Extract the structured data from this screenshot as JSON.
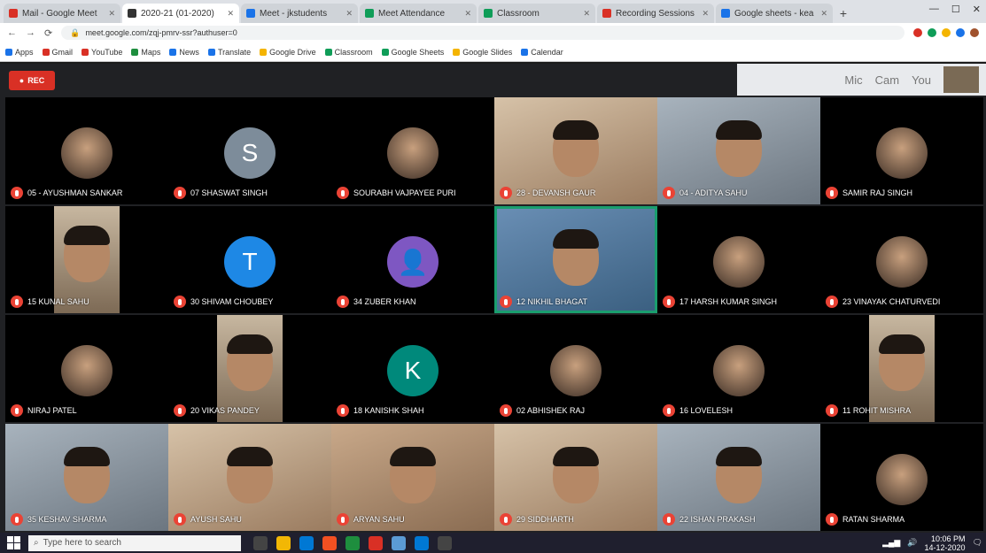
{
  "browser": {
    "tabs": [
      {
        "label": "Mail - Google Meet",
        "color": "#d93025",
        "active": false
      },
      {
        "label": "2020-21 (01-2020)",
        "color": "#333333",
        "active": true
      },
      {
        "label": "Meet - jkstudents",
        "color": "#1a73e8",
        "active": false
      },
      {
        "label": "Meet Attendance",
        "color": "#0f9d58",
        "active": false
      },
      {
        "label": "Classroom",
        "color": "#0f9d58",
        "active": false
      },
      {
        "label": "Recording Sessions",
        "color": "#d93025",
        "active": false
      },
      {
        "label": "Google sheets - kea",
        "color": "#1a73e8",
        "active": false
      }
    ],
    "url": "meet.google.com/zqj-pmrv-ssr?authuser=0",
    "bookmarks": [
      "Apps",
      "Gmail",
      "YouTube",
      "Maps",
      "News",
      "Translate",
      "Google Drive",
      "Classroom",
      "Google Sheets",
      "Google Slides",
      "Calendar"
    ]
  },
  "meet": {
    "presenting_label": "REC",
    "self_view_labels": [
      "Mic",
      "Cam",
      "You"
    ],
    "participants": [
      {
        "name": "05 - AYUSHMAN SANKAR",
        "kind": "photo",
        "speaking": false
      },
      {
        "name": "07 SHASWAT SINGH",
        "kind": "letter",
        "letter": "S",
        "bg": "#7d8c9a",
        "speaking": false
      },
      {
        "name": "SOURABH VAJPAYEE PURI",
        "kind": "photo",
        "speaking": false
      },
      {
        "name": "28 - DEVANSH GAUR",
        "kind": "video",
        "variant": "v3",
        "speaking": false
      },
      {
        "name": "04 - ADITYA SAHU",
        "kind": "video",
        "variant": "v2",
        "speaking": false
      },
      {
        "name": "SAMIR RAJ SINGH",
        "kind": "photo",
        "speaking": false
      },
      {
        "name": "15 KUNAL SAHU",
        "kind": "video-portrait",
        "speaking": false
      },
      {
        "name": "30 SHIVAM CHOUBEY",
        "kind": "letter",
        "letter": "T",
        "bg": "#1e88e5",
        "speaking": false
      },
      {
        "name": "34 ZUBER KHAN",
        "kind": "generic",
        "bg": "#7e57c2",
        "speaking": false
      },
      {
        "name": "12 NIKHIL BHAGAT",
        "kind": "video",
        "variant": "v4",
        "speaking": true
      },
      {
        "name": "17 HARSH KUMAR SINGH",
        "kind": "photo",
        "speaking": false
      },
      {
        "name": "23 VINAYAK CHATURVEDI",
        "kind": "photo",
        "speaking": false
      },
      {
        "name": "NIRAJ PATEL",
        "kind": "photo",
        "speaking": false
      },
      {
        "name": "20 VIKAS PANDEY",
        "kind": "video-portrait",
        "speaking": false
      },
      {
        "name": "18 KANISHK SHAH",
        "kind": "letter",
        "letter": "K",
        "bg": "#00897b",
        "speaking": false
      },
      {
        "name": "02 ABHISHEK RAJ",
        "kind": "photo",
        "speaking": false
      },
      {
        "name": "16 LOVELESH",
        "kind": "photo",
        "speaking": false
      },
      {
        "name": "11 ROHIT MISHRA",
        "kind": "video-portrait",
        "speaking": false
      },
      {
        "name": "35 KESHAV SHARMA",
        "kind": "video",
        "variant": "v2",
        "speaking": false
      },
      {
        "name": "AYUSH SAHU",
        "kind": "video",
        "variant": "v3",
        "speaking": false
      },
      {
        "name": "ARYAN SAHU",
        "kind": "video",
        "variant": "v1",
        "speaking": false
      },
      {
        "name": "29 SIDDHARTH",
        "kind": "video",
        "variant": "v3",
        "speaking": false
      },
      {
        "name": "22 ISHAN PRAKASH",
        "kind": "video",
        "variant": "v2",
        "speaking": false
      },
      {
        "name": "RATAN SHARMA",
        "kind": "photo",
        "speaking": false
      }
    ]
  },
  "taskbar": {
    "search_placeholder": "Type here to search",
    "time": "10:06 PM",
    "date": "14-12-2020",
    "apps": [
      "#444",
      "#f2b705",
      "#0078d4",
      "#f25022",
      "#1e8e3e",
      "#d93025",
      "#5b9bd5",
      "#0078d4",
      "#444"
    ]
  }
}
